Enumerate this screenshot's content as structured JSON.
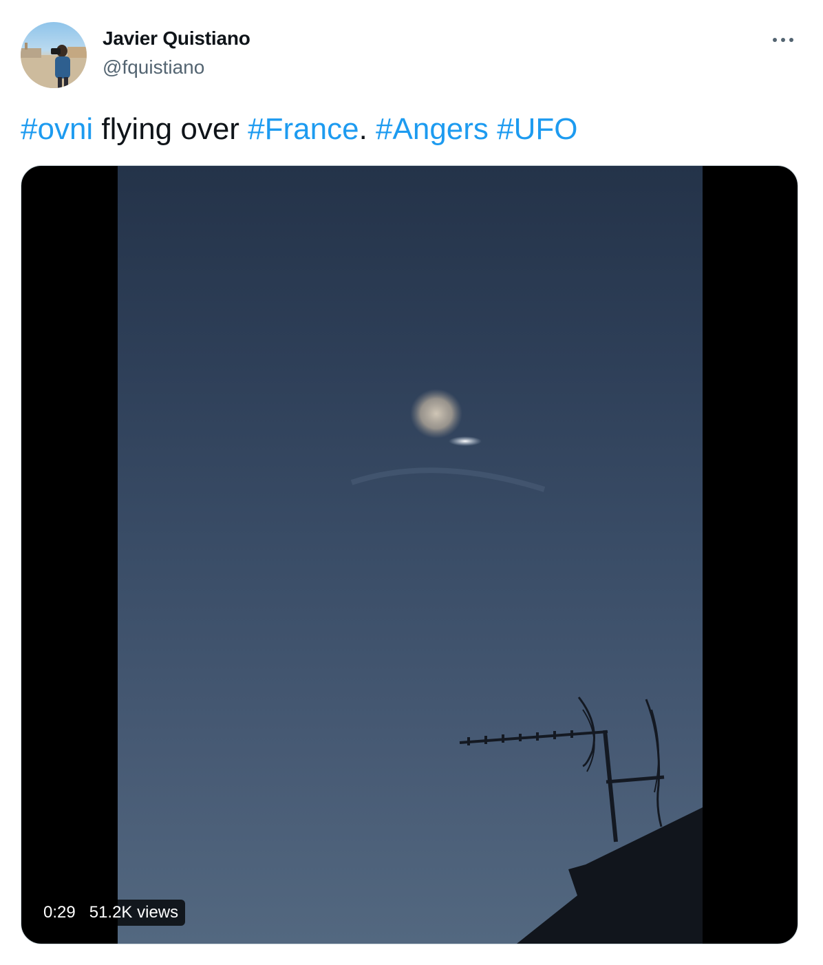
{
  "author": {
    "name": "Javier Quistiano",
    "handle": "@fquistiano"
  },
  "tweet": {
    "segments": [
      {
        "text": "#ovni",
        "hashtag": true
      },
      {
        "text": " flying over ",
        "hashtag": false
      },
      {
        "text": "#France",
        "hashtag": true
      },
      {
        "text": ". ",
        "hashtag": false
      },
      {
        "text": "#Angers",
        "hashtag": true
      },
      {
        "text": " ",
        "hashtag": false
      },
      {
        "text": "#UFO",
        "hashtag": true
      }
    ]
  },
  "media": {
    "duration": "0:29",
    "views": "51.2K views"
  },
  "icons": {
    "more": "more-horizontal-icon"
  },
  "colors": {
    "hashtag": "#1d9bf0",
    "text": "#0f1419",
    "secondary": "#536471"
  }
}
